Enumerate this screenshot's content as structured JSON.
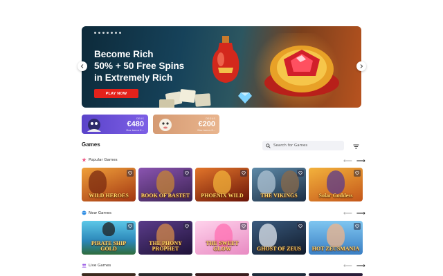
{
  "hero": {
    "title_line1": "Become Rich",
    "title_line2": "50% + 50 Free Spins",
    "title_line3": "in Extremely Rich",
    "cta_label": "PLAY NOW",
    "prev_icon": "chevron-left-icon",
    "next_icon": "chevron-right-icon"
  },
  "promos": [
    {
      "tag": "DEUS",
      "amount": "€480",
      "sub": "Max bonus €...",
      "color": "#6a50d8"
    },
    {
      "tag": "DEGUS",
      "amount": "€200",
      "sub": "Max bonus €...",
      "color": "#dfa882"
    }
  ],
  "games": {
    "title": "Games",
    "search_placeholder": "Search for Games",
    "filter_icon": "filter-icon"
  },
  "sections": [
    {
      "label": "Popular Games",
      "icon": "star-icon",
      "tiles": [
        {
          "name": "WILD HEROES",
          "bg": "#c65a21"
        },
        {
          "name": "BOOK OF BASTET",
          "bg": "#6b3c8a"
        },
        {
          "name": "PHOENIX WILD",
          "bg": "#a32f1a"
        },
        {
          "name": "THE VIKINGS",
          "bg": "#2f4e6c"
        },
        {
          "name": "Solar Goddess",
          "bg": "#e08b1f"
        }
      ]
    },
    {
      "label": "New Games",
      "icon": "globe-icon",
      "tiles": [
        {
          "name": "PIRATE SHIP GOLD",
          "bg": "#2aa5c9"
        },
        {
          "name": "THE PHONY PROPHET",
          "bg": "#3b2a6b"
        },
        {
          "name": "THE SWEET GLOW",
          "bg": "#f0a7d4"
        },
        {
          "name": "GHOST OF ZEUS",
          "bg": "#28425e"
        },
        {
          "name": "HOT ZEUSMANIA",
          "bg": "#3c8fd1"
        }
      ]
    },
    {
      "label": "Live Games",
      "icon": "users-icon",
      "tiles": []
    }
  ]
}
